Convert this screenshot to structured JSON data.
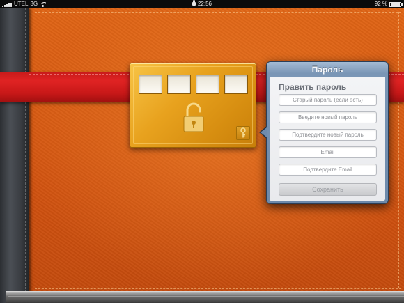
{
  "status_bar": {
    "carrier": "UTEL",
    "network": "3G",
    "time": "22:56",
    "battery": "92 %"
  },
  "lock": {
    "digits": [
      "",
      "",
      "",
      ""
    ]
  },
  "popover": {
    "title": "Пароль",
    "section_title": "Править пароль",
    "fields": {
      "old_password": {
        "placeholder": "Старый пароль (если есть)",
        "value": ""
      },
      "new_password": {
        "placeholder": "Введите новый пароль",
        "value": ""
      },
      "confirm_password": {
        "placeholder": "Подтвердите новый пароль",
        "value": ""
      },
      "email": {
        "placeholder": "Email",
        "value": ""
      },
      "confirm_email": {
        "placeholder": "Подтвердите Email",
        "value": ""
      }
    },
    "save_label": "Сохранить"
  },
  "icons": [
    "signal-icon",
    "wifi-icon",
    "screen-lock-icon",
    "battery-icon",
    "padlock-icon",
    "key-icon"
  ],
  "colors": {
    "leather": "#d9590f",
    "strap": "#d91e1e",
    "lock_gold": "#e8a21e",
    "popover_header": "#7a96b6"
  }
}
